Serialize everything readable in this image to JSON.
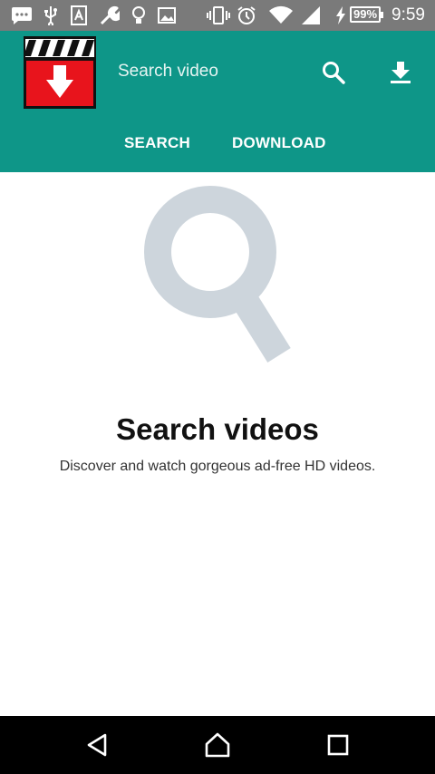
{
  "status_bar": {
    "icons": [
      "chat-notification-icon",
      "usb-icon",
      "a-badge-icon",
      "wrench-icon",
      "lightbulb-icon",
      "image-icon",
      "vibrate-icon",
      "alarm-icon",
      "wifi-icon",
      "signal-icon",
      "charging-icon"
    ],
    "battery": "99%",
    "time": "9:59"
  },
  "app_bar": {
    "logo_icon": "video-download-logo",
    "search_placeholder": "Search video",
    "actions": [
      "search-icon",
      "download-icon"
    ],
    "color": "#0e9688",
    "tabs": [
      {
        "label": "SEARCH",
        "selected": true
      },
      {
        "label": "DOWNLOAD",
        "selected": false
      }
    ]
  },
  "empty_state": {
    "icon": "magnifier-icon",
    "title": "Search videos",
    "description": "Discover and watch gorgeous ad-free HD videos."
  },
  "nav_bar": {
    "buttons": [
      "back-icon",
      "home-icon",
      "recents-icon"
    ]
  }
}
